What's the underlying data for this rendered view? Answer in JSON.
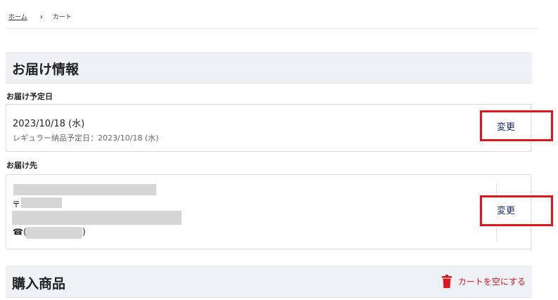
{
  "breadcrumb": {
    "home": "ホーム",
    "separator": "›",
    "current": "カート"
  },
  "delivery_section": {
    "title": "お届け情報"
  },
  "delivery_date": {
    "label": "お届け予定日",
    "date": "2023/10/18 (水)",
    "regular": "レギュラー納品予定日：2023/10/18 (水)",
    "change_label": "変更"
  },
  "delivery_address": {
    "label": "お届け先",
    "postal_mark": "〒",
    "phone_open": "☎(",
    "phone_close": ")",
    "change_label": "変更"
  },
  "purchase_section": {
    "title": "購入商品",
    "empty_cart_label": "カートを空にする"
  },
  "colors": {
    "accent_red": "#e0161f",
    "header_bg": "#eef1f6",
    "link_navy": "#1a2a6c"
  },
  "icons": {
    "empty_cart": "trash-icon"
  }
}
